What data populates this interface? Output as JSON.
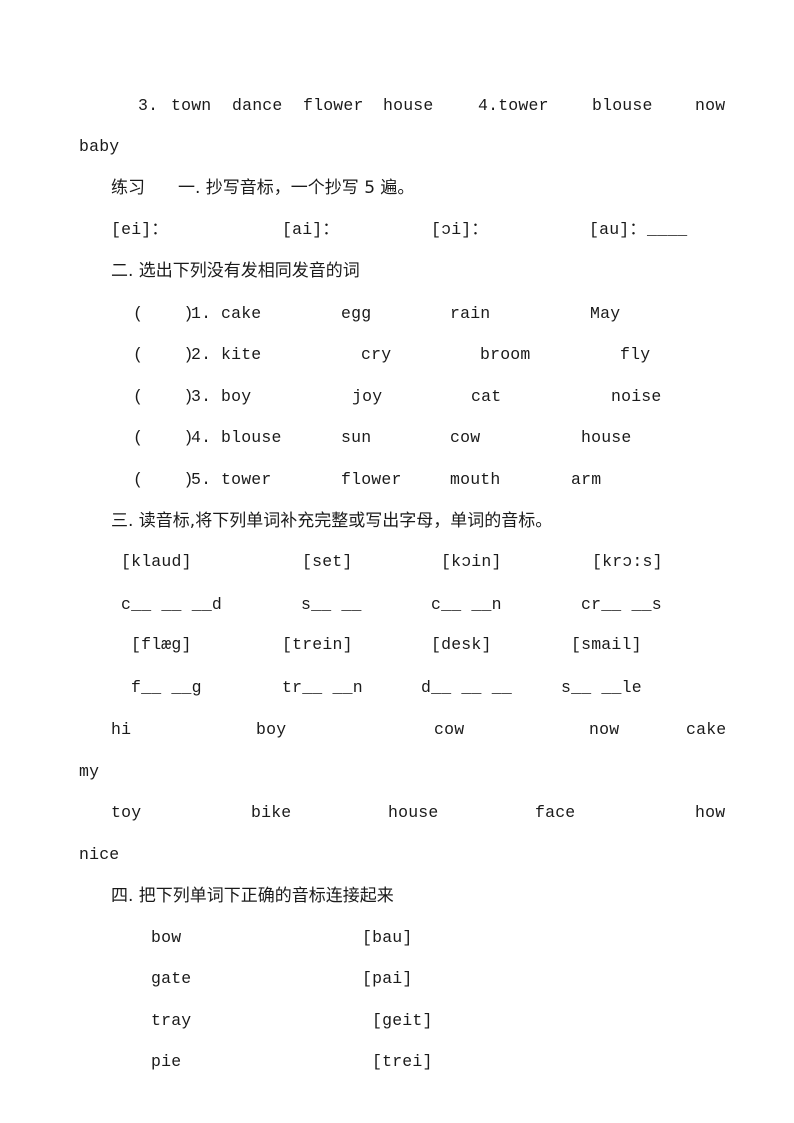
{
  "top_line": {
    "item3_num": "3.",
    "item3_words": [
      "town",
      "dance",
      "flower",
      "house"
    ],
    "item4_label": "4.tower",
    "item4_words": [
      "blouse",
      "now"
    ],
    "wrap_word": "baby"
  },
  "practice": {
    "label": "练习",
    "section1_title": "一. 抄写音标，一个抄写 5 遍。",
    "phonetics": [
      "[ei]：",
      "[ai]：",
      "[ɔi]：",
      "[au]："
    ],
    "blank": "____"
  },
  "section2": {
    "title": "二. 选出下列没有发相同发音的词",
    "bracket": "(    )",
    "rows": [
      {
        "num": "1.",
        "words": [
          "cake",
          "egg",
          "rain",
          "May"
        ]
      },
      {
        "num": "2.",
        "words": [
          "kite",
          "cry",
          "broom",
          "fly"
        ]
      },
      {
        "num": "3.",
        "words": [
          "boy",
          "joy",
          "cat",
          "noise"
        ]
      },
      {
        "num": "4.",
        "words": [
          "blouse",
          "sun",
          "cow",
          "house"
        ]
      },
      {
        "num": "5.",
        "words": [
          "tower",
          "flower",
          "mouth",
          "arm"
        ]
      }
    ]
  },
  "section3": {
    "title": "三. 读音标,将下列单词补充完整或写出字母，单词的音标。",
    "group1_phonetics": [
      "[klaud]",
      "[set]",
      "[kɔin]",
      "[krɔ:s]"
    ],
    "group1_blanks": [
      "c__ __ __d",
      "s__ __",
      "c__ __n",
      "cr__ __s"
    ],
    "group2_phonetics": [
      "[flæg]",
      "[trein]",
      "[desk]",
      "[smail]"
    ],
    "group2_blanks": [
      "f__ __g",
      "tr__ __n",
      "d__ __ __",
      "s__ __le"
    ],
    "words_row1": [
      "hi",
      "boy",
      "cow",
      "now",
      "cake"
    ],
    "words_row1_wrap": "my",
    "words_row2": [
      "toy",
      "bike",
      "house",
      "face",
      "how"
    ],
    "words_row2_wrap": "nice"
  },
  "section4": {
    "title": "四. 把下列单词下正确的音标连接起来",
    "words": [
      "bow",
      "gate",
      "tray",
      "pie"
    ],
    "phonetics": [
      "[bau]",
      "[pai]",
      "[geit]",
      "[trei]"
    ]
  }
}
